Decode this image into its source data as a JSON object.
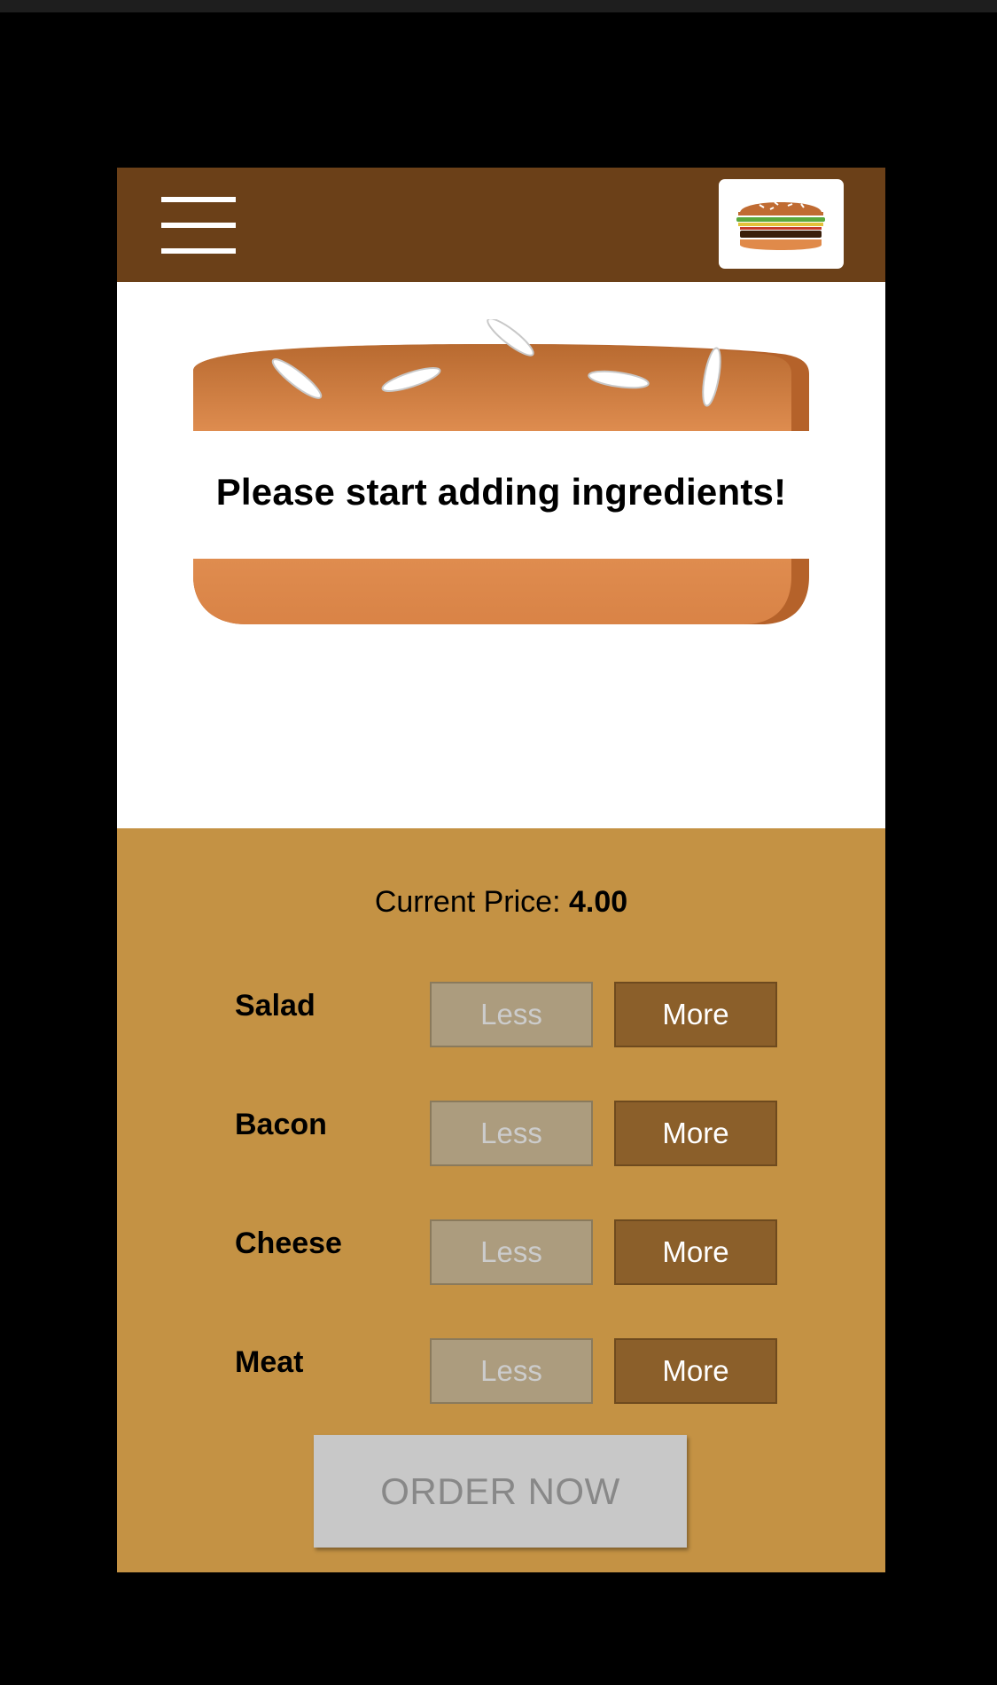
{
  "toolbar": {
    "menu_icon": "hamburger-menu-icon",
    "logo_icon": "burger-logo-icon",
    "color": "#6b4018"
  },
  "preview": {
    "prompt": "Please start adding ingredients!"
  },
  "controls": {
    "price_label": "Current Price:",
    "price_value": "4.00",
    "ingredients": [
      {
        "label": "Salad",
        "less": "Less",
        "more": "More"
      },
      {
        "label": "Bacon",
        "less": "Less",
        "more": "More"
      },
      {
        "label": "Cheese",
        "less": "Less",
        "more": "More"
      },
      {
        "label": "Meat",
        "less": "Less",
        "more": "More"
      }
    ],
    "order_label": "ORDER NOW",
    "color": "#c49244"
  }
}
